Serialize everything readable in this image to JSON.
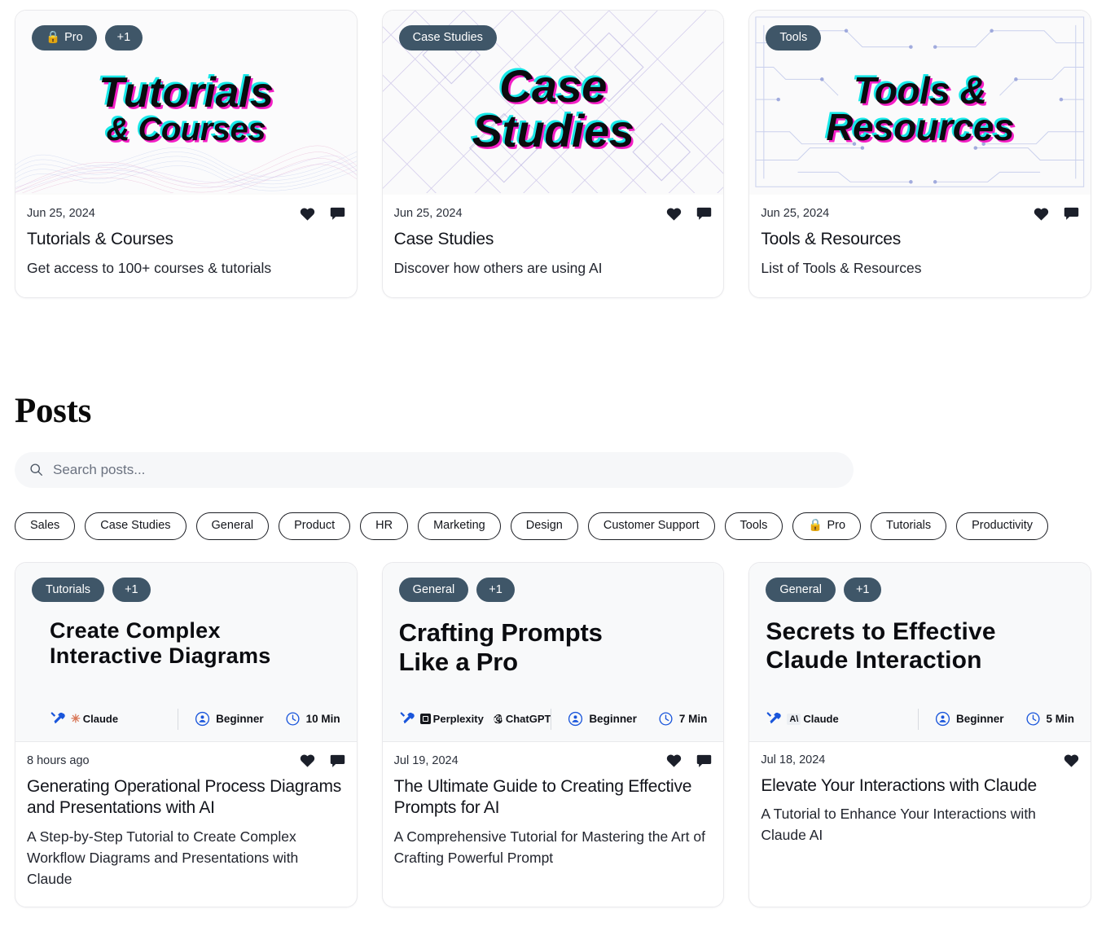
{
  "hero_cards": [
    {
      "badges": [
        "Pro",
        "+1"
      ],
      "badge_has_lock": true,
      "banner_title_line1": "Tutorials",
      "banner_title_line2": "& Courses",
      "banner_pattern": "wave-lines",
      "date": "Jun 25, 2024",
      "title": "Tutorials & Courses",
      "subtitle": "Get access to 100+ courses & tutorials",
      "icons": [
        "heart-icon",
        "comment-icon"
      ]
    },
    {
      "badges": [
        "Case Studies"
      ],
      "badge_has_lock": false,
      "banner_title_line1": "Case",
      "banner_title_line2": "Studies",
      "banner_pattern": "diagonal-maze",
      "date": "Jun 25, 2024",
      "title": "Case Studies",
      "subtitle": "Discover how others are using AI",
      "icons": [
        "heart-icon",
        "comment-icon"
      ]
    },
    {
      "badges": [
        "Tools"
      ],
      "badge_has_lock": false,
      "banner_title_line1": "Tools &",
      "banner_title_line2": "Resources",
      "banner_pattern": "circuit-board",
      "date": "Jun 25, 2024",
      "title": "Tools & Resources",
      "subtitle": "List of Tools & Resources",
      "icons": [
        "heart-icon",
        "comment-icon"
      ]
    }
  ],
  "posts_section": {
    "heading": "Posts",
    "search": {
      "placeholder": "Search posts...",
      "value": ""
    },
    "chips": [
      {
        "label": "Sales",
        "lock": false
      },
      {
        "label": "Case Studies",
        "lock": false
      },
      {
        "label": "General",
        "lock": false
      },
      {
        "label": "Product",
        "lock": false
      },
      {
        "label": "HR",
        "lock": false
      },
      {
        "label": "Marketing",
        "lock": false
      },
      {
        "label": "Design",
        "lock": false
      },
      {
        "label": "Customer Support",
        "lock": false
      },
      {
        "label": "Tools",
        "lock": false
      },
      {
        "label": "Pro",
        "lock": true
      },
      {
        "label": "Tutorials",
        "lock": false
      },
      {
        "label": "Productivity",
        "lock": false
      }
    ]
  },
  "post_cards": [
    {
      "badges": [
        "Tutorials",
        "+1"
      ],
      "head_title_line1": "Create Complex",
      "head_title_line2": "Interactive Diagrams",
      "tools": [
        {
          "name": "Claude",
          "glyph": "claude-sparkle"
        }
      ],
      "level": "Beginner",
      "duration": "10 Min",
      "date": "8 hours ago",
      "title": "Generating Operational Process Diagrams and Presentations with AI",
      "subtitle": "A Step-by-Step Tutorial to Create Complex Workflow Diagrams and Presentations with Claude",
      "icons": [
        "heart-icon",
        "comment-icon"
      ]
    },
    {
      "badges": [
        "General",
        "+1"
      ],
      "head_title_line1": "Crafting Prompts",
      "head_title_line2": "Like a Pro",
      "tools": [
        {
          "name": "Perplexity",
          "glyph": "perplexity-mark"
        },
        {
          "name": "ChatGPT",
          "glyph": "openai-mark"
        }
      ],
      "level": "Beginner",
      "duration": "7 Min",
      "date": "Jul 19, 2024",
      "title": "The Ultimate Guide to Creating Effective Prompts for AI",
      "subtitle": "A Comprehensive Tutorial for Mastering the Art of Crafting Powerful Prompt",
      "icons": [
        "heart-icon",
        "comment-icon"
      ]
    },
    {
      "badges": [
        "General",
        "+1"
      ],
      "head_title_line1": "Secrets to Effective",
      "head_title_line2": "Claude Interaction",
      "tools": [
        {
          "name": "Claude",
          "glyph": "anthropic-mark"
        }
      ],
      "level": "Beginner",
      "duration": "5 Min",
      "date": "Jul 18, 2024",
      "title": "Elevate Your Interactions with Claude",
      "subtitle": "A Tutorial to Enhance Your Interactions with Claude AI",
      "icons": [
        "heart-icon"
      ]
    }
  ],
  "colors": {
    "badge_bg": "#3f5668",
    "glitch_cyan": "#18e8e8",
    "glitch_magenta": "#f41fc6",
    "meta_blue": "#1a56db",
    "card_border": "#e9e9ec",
    "search_bg": "#f6f7f9",
    "post_head_bg": "#f8f9fa"
  }
}
